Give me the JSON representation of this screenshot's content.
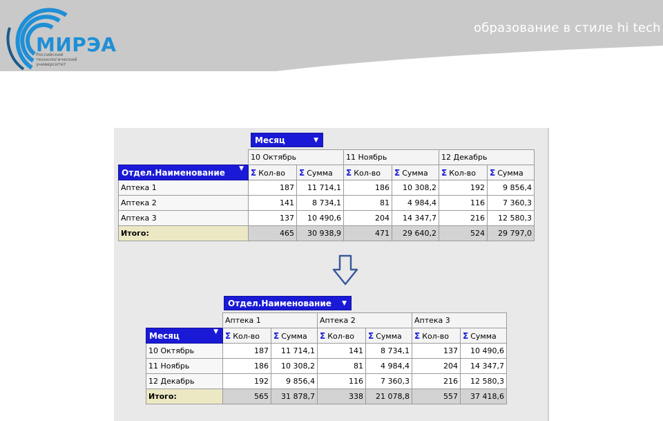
{
  "header": {
    "slogan": "образование в стиле hi tech",
    "logo_name": "МИРЭА",
    "logo_subtitle": "Российский технологический университет",
    "band_color": "#c9c9c9"
  },
  "pivot1": {
    "column_field": "Месяц",
    "row_field": "Отдел.Наименование",
    "columns": [
      "10 Октябрь",
      "11 Ноябрь",
      "12 Декабрь"
    ],
    "measures": [
      "Кол-во",
      "Сумма"
    ],
    "rows": [
      {
        "label": "Аптека 1",
        "values": [
          "187",
          "11 714,1",
          "186",
          "10 308,2",
          "192",
          "9 856,4"
        ]
      },
      {
        "label": "Аптека 2",
        "values": [
          "141",
          "8 734,1",
          "81",
          "4 984,4",
          "116",
          "7 360,3"
        ]
      },
      {
        "label": "Аптека 3",
        "values": [
          "137",
          "10 490,6",
          "204",
          "14 347,7",
          "216",
          "12 580,3"
        ]
      }
    ],
    "total": {
      "label": "Итого:",
      "values": [
        "465",
        "30 938,9",
        "471",
        "29 640,2",
        "524",
        "29 797,0"
      ]
    }
  },
  "pivot2": {
    "column_field": "Отдел.Наименование",
    "row_field": "Месяц",
    "columns": [
      "Аптека 1",
      "Аптека 2",
      "Аптека 3"
    ],
    "measures": [
      "Кол-во",
      "Сумма"
    ],
    "rows": [
      {
        "label": "10 Октябрь",
        "values": [
          "187",
          "11 714,1",
          "141",
          "8 734,1",
          "137",
          "10 490,6"
        ]
      },
      {
        "label": "11 Ноябрь",
        "values": [
          "186",
          "10 308,2",
          "81",
          "4 984,4",
          "204",
          "14 347,7"
        ]
      },
      {
        "label": "12 Декабрь",
        "values": [
          "192",
          "9 856,4",
          "116",
          "7 360,3",
          "216",
          "12 580,3"
        ]
      }
    ],
    "total": {
      "label": "Итого:",
      "values": [
        "565",
        "31 878,7",
        "338",
        "21 078,8",
        "557",
        "37 418,6"
      ]
    }
  },
  "arrow_icon": "down-arrow-icon",
  "sigma_glyph": "Σ",
  "dropdown_glyph": "▼"
}
